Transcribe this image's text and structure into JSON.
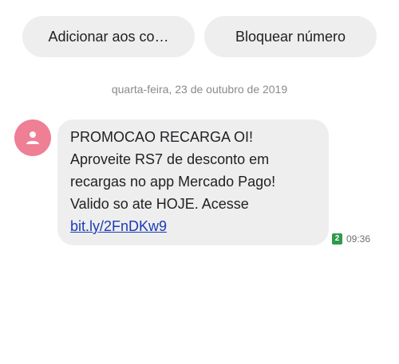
{
  "actions": {
    "add_contact_label": "Adicionar aos co…",
    "block_number_label": "Bloquear número"
  },
  "conversation": {
    "date_separator": "quarta-feira, 23 de outubro de 2019",
    "message": {
      "lines": [
        "PROMOCAO RECARGA OI!",
        "Aproveite RS7 de desconto em",
        "recargas no app Mercado Pago!",
        "Valido so ate HOJE. Acesse"
      ],
      "link": "bit.ly/2FnDKw9",
      "sim_slot": "2",
      "time": "09:36"
    },
    "avatar_icon": "person-icon",
    "avatar_color": "#ee7f95",
    "sim_badge_color": "#2e9a4a",
    "link_color": "#1a3cb5"
  }
}
